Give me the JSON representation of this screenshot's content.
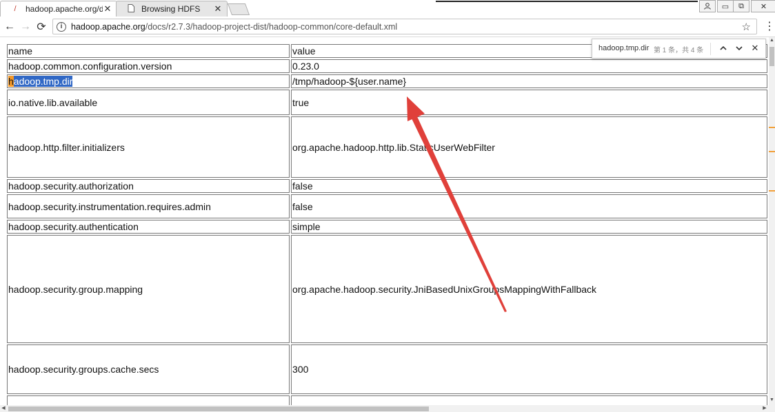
{
  "browser": {
    "tabs": [
      {
        "title": "hadoop.apache.org/dc",
        "active": true,
        "close": "✕"
      },
      {
        "title": "Browsing HDFS",
        "active": false,
        "close": "✕"
      }
    ],
    "url_host": "hadoop.apache.org",
    "url_path": "/docs/r2.7.3/hadoop-project-dist/hadoop-common/core-default.xml",
    "bookmark_icon": "star-icon",
    "menu_icon": "three-dots-icon"
  },
  "find_bar": {
    "query": "hadoop.tmp.dir",
    "count": "第 1 条，共 4 条"
  },
  "table": {
    "header": {
      "name": "name",
      "value": "value"
    },
    "rows": [
      {
        "name": "hadoop.common.configuration.version",
        "value": "0.23.0"
      },
      {
        "name_first": "h",
        "name_rest": "adoop.tmp.dir",
        "value": "/tmp/hadoop-${user.name}"
      },
      {
        "name": "io.native.lib.available",
        "value": "true"
      },
      {
        "name": "hadoop.http.filter.initializers",
        "value": "org.apache.hadoop.http.lib.StaticUserWebFilter"
      },
      {
        "name": "hadoop.security.authorization",
        "value": "false"
      },
      {
        "name": "hadoop.security.instrumentation.requires.admin",
        "value": "false"
      },
      {
        "name": "hadoop.security.authentication",
        "value": "simple"
      },
      {
        "name": "hadoop.security.group.mapping",
        "value": "org.apache.hadoop.security.JniBasedUnixGroupsMappingWithFallback"
      },
      {
        "name": "hadoop.security.groups.cache.secs",
        "value": "300"
      }
    ]
  },
  "colors": {
    "selection": "#3168c5",
    "current_match": "#f59a2a",
    "annotation_arrow": "#e0403a"
  }
}
